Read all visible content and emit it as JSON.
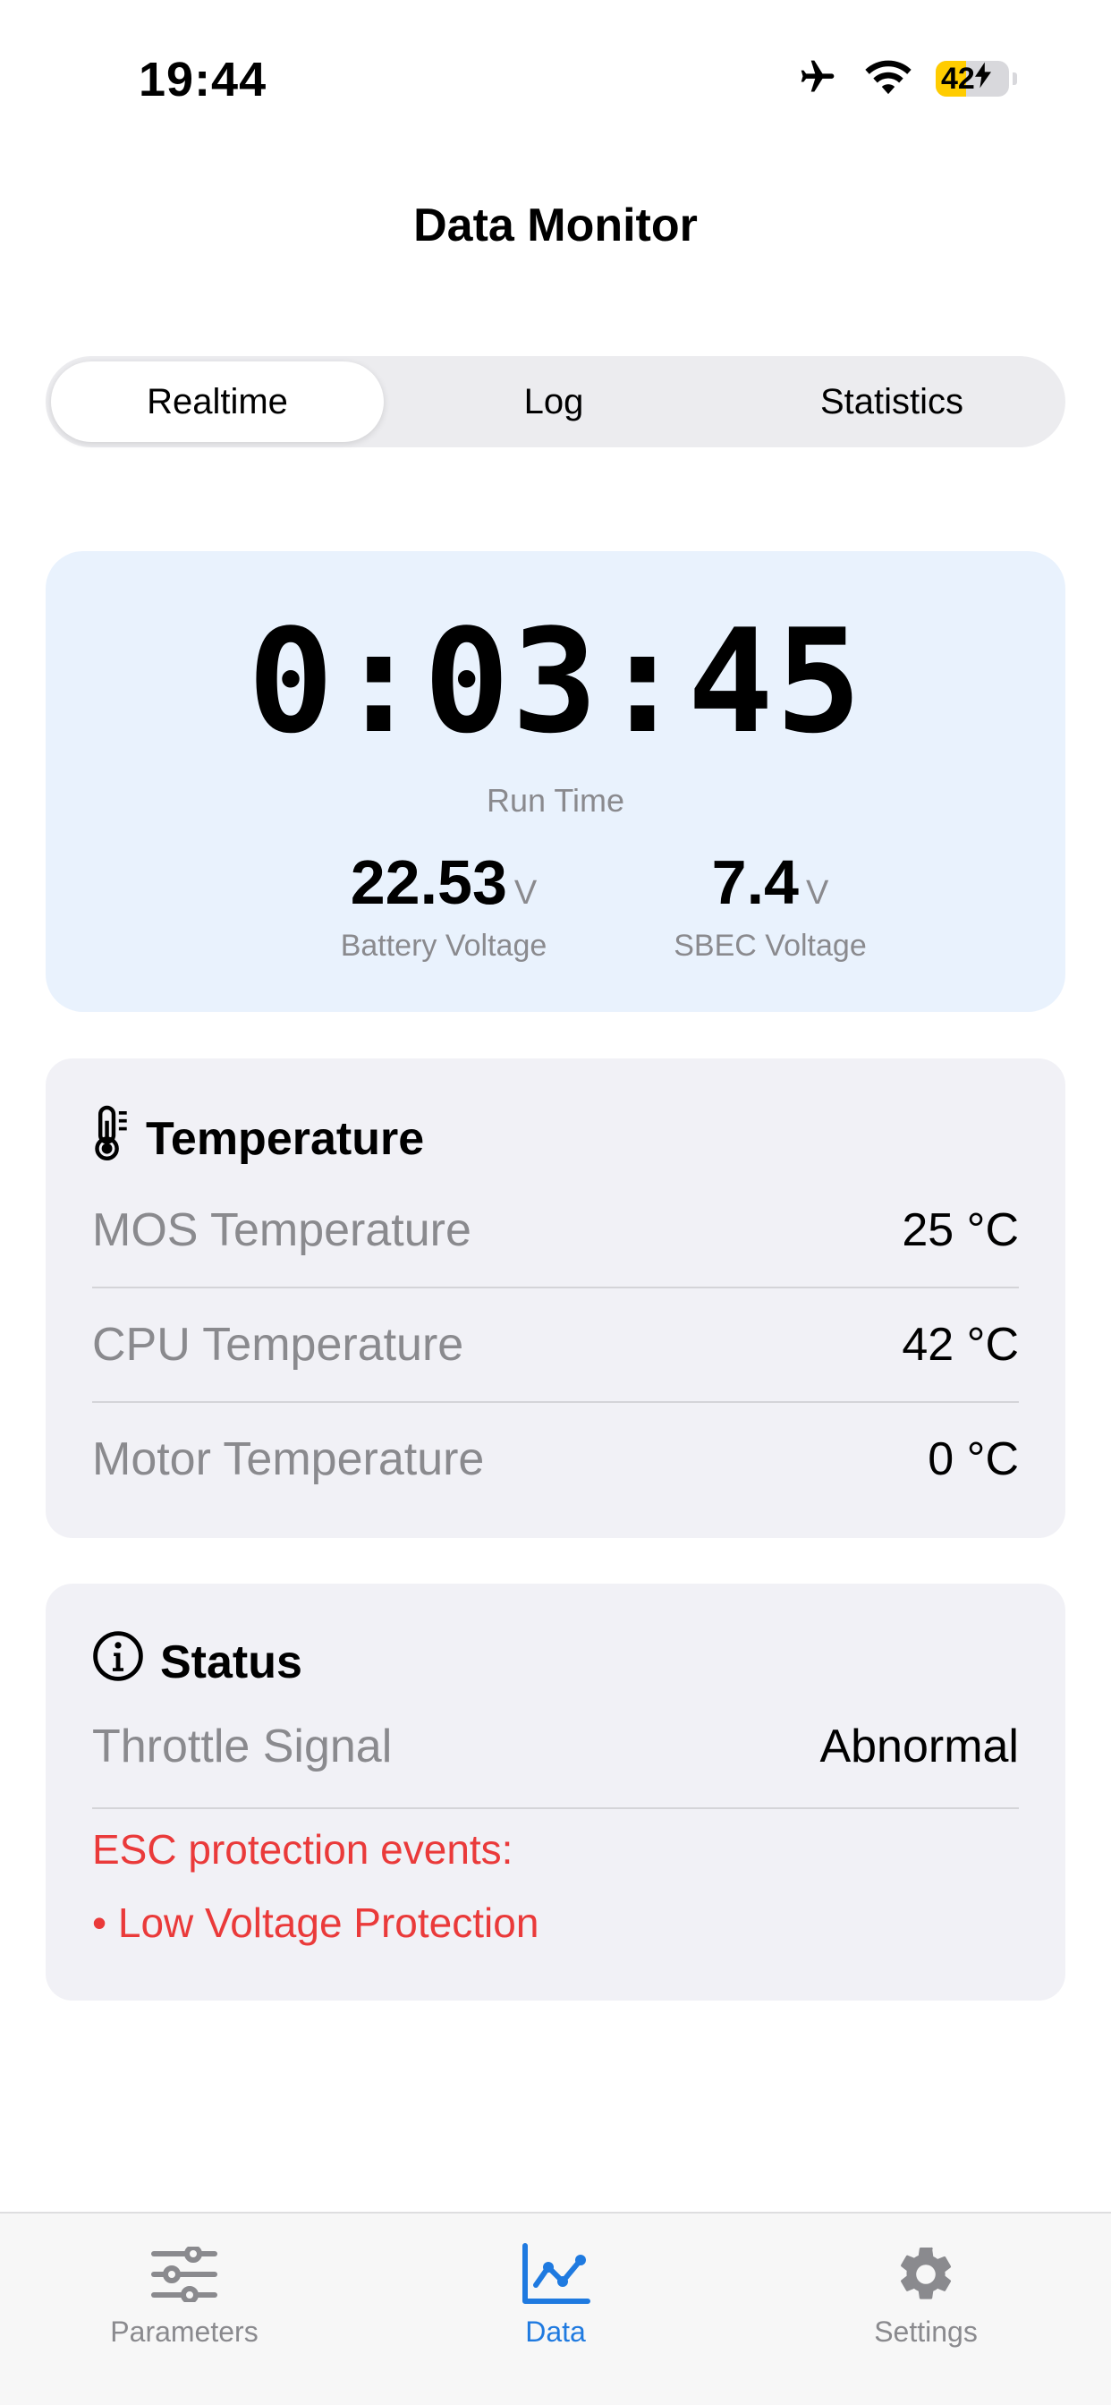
{
  "status_bar": {
    "time": "19:44",
    "battery_level": "42",
    "battery_fill": 0.42,
    "icons": [
      "airplane-icon",
      "wifi-icon",
      "battery-icon",
      "charging-bolt-icon"
    ]
  },
  "nav": {
    "title": "Data Monitor"
  },
  "segments": [
    {
      "label": "Realtime",
      "selected": true
    },
    {
      "label": "Log",
      "selected": false
    },
    {
      "label": "Statistics",
      "selected": false
    }
  ],
  "runtime": {
    "value": "0:03:45",
    "label": "Run Time",
    "battery_voltage": {
      "value": "22.53",
      "unit": "V",
      "label": "Battery Voltage"
    },
    "sbec_voltage": {
      "value": "7.4",
      "unit": "V",
      "label": "SBEC Voltage"
    }
  },
  "temperature": {
    "title": "Temperature",
    "icon": "thermometer-icon",
    "rows": [
      {
        "label": "MOS Temperature",
        "value": "25 °C"
      },
      {
        "label": "CPU Temperature",
        "value": "42 °C"
      },
      {
        "label": "Motor Temperature",
        "value": "0 °C"
      }
    ]
  },
  "status": {
    "title": "Status",
    "icon": "info-icon",
    "rows": [
      {
        "label": "Throttle Signal",
        "value": "Abnormal"
      }
    ],
    "alert_title": "ESC protection events:",
    "alerts": [
      "• Low Voltage Protection"
    ],
    "alert_color": "#ea3a3a"
  },
  "tabs": [
    {
      "label": "Parameters",
      "icon": "sliders-icon",
      "active": false
    },
    {
      "label": "Data",
      "icon": "chart-icon",
      "active": true
    },
    {
      "label": "Settings",
      "icon": "gear-icon",
      "active": false
    }
  ],
  "colors": {
    "accent": "#1f7ae0",
    "runtime_card_bg": "#e9f2fd",
    "card_bg": "#f1f1f6",
    "battery_yellow": "#ffcc00"
  }
}
